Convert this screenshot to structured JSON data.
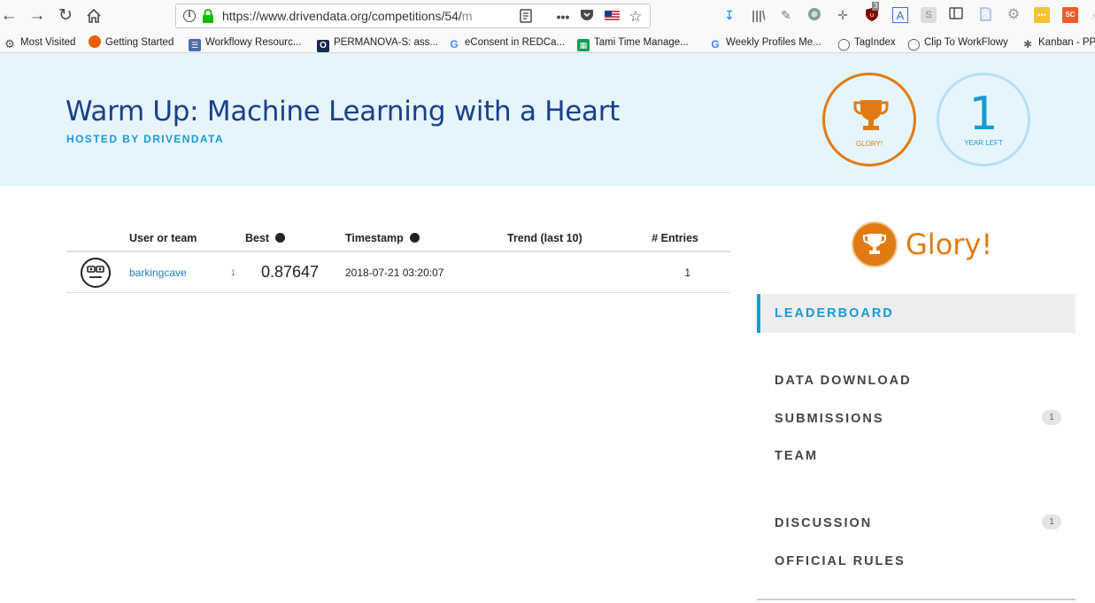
{
  "browser": {
    "url_main": "https://www.drivendata.org/competitions/54/",
    "url_faded": "m",
    "bookmarks": [
      {
        "label": "Most Visited",
        "icon": "gear-icon"
      },
      {
        "label": "Getting Started",
        "icon": "firefox-icon"
      },
      {
        "label": "Workflowy Resourc...",
        "icon": "list-icon"
      },
      {
        "label": "PERMANOVA-S: ass...",
        "icon": "o-icon"
      },
      {
        "label": "eConsent in REDCa...",
        "icon": "google-icon"
      },
      {
        "label": "Tami Time Manage...",
        "icon": "sheet-icon"
      },
      {
        "label": "Weekly Profiles Me...",
        "icon": "google-icon"
      },
      {
        "label": "TagIndex",
        "icon": "globe-icon"
      },
      {
        "label": "Clip To WorkFlowy",
        "icon": "globe-icon"
      },
      {
        "label": "Kanban - PP",
        "icon": "puzzle-icon"
      }
    ],
    "toolbar_badge": "3"
  },
  "header": {
    "title": "Warm Up: Machine Learning with a Heart",
    "hosted_by": "HOSTED BY DRIVENDATA",
    "prize_label": "GLORY!",
    "time_number": "1",
    "time_label": "YEAR LEFT"
  },
  "leaderboard": {
    "columns": {
      "user": "User or team",
      "best": "Best",
      "timestamp": "Timestamp",
      "trend": "Trend (last 10)",
      "entries": "# Entries"
    },
    "rows": [
      {
        "rank": "1",
        "user": "barkingcave",
        "best": "0.87647",
        "timestamp": "2018-07-21 03:20:07",
        "entries": "1"
      }
    ]
  },
  "sidebar": {
    "prize_title": "Glory!",
    "nav": [
      {
        "label": "LEADERBOARD",
        "active": true
      },
      {
        "label": "DATA DOWNLOAD"
      },
      {
        "label": "SUBMISSIONS",
        "count": "1"
      },
      {
        "label": "TEAM"
      },
      {
        "label": "DISCUSSION",
        "count": "1"
      },
      {
        "label": "OFFICIAL RULES"
      }
    ]
  },
  "colors": {
    "brand_blue": "#19408c",
    "accent_blue": "#1a9ad6",
    "prize_orange": "#e07b14",
    "banner_bg": "#e6f5fb"
  }
}
